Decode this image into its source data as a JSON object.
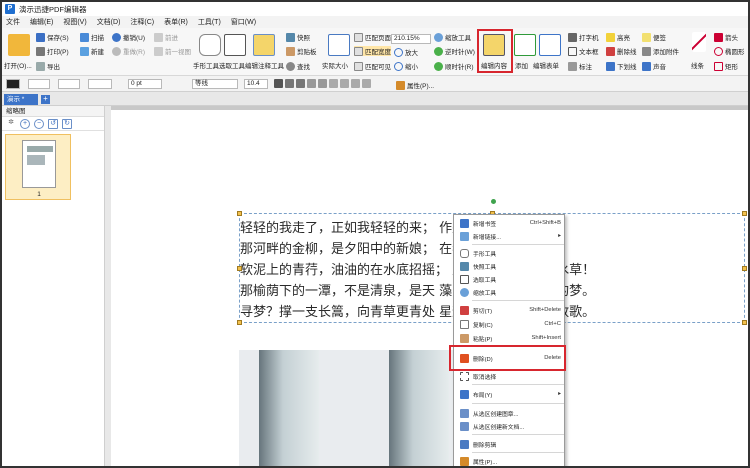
{
  "window": {
    "title": "演示迅捷PDF编辑器"
  },
  "menu": [
    "文件",
    "编辑(E)",
    "视图(V)",
    "文档(D)",
    "注释(C)",
    "表单(R)",
    "工具(T)",
    "窗口(W)"
  ],
  "ribbon": {
    "open": "打开(O)...",
    "save": "保存(S)",
    "scan": "扫描",
    "undo": "撤销(U)",
    "redo": "重做(R)",
    "forward": "前进",
    "back": "前一视图",
    "print": "打印(P)",
    "new": "新建",
    "export": "导出",
    "hand_tool": "手形工具",
    "select_tool": "选取工具",
    "edit_anno_tool": "编辑注释工具",
    "snapshot": "快照",
    "clipboard": "剪贴板",
    "find": "查找",
    "actual_size": "实际大小",
    "fit_page": "匹配页面",
    "fit_width": "匹配宽度",
    "fit_visible": "匹配可见",
    "zoom_value": "210.15%",
    "zoom_in": "放大",
    "zoom_out": "缩小",
    "zoom_tool": "缩放工具",
    "rotate_cw": "逆时针(W)",
    "rotate_ccw": "顺时针(R)",
    "edit_content": "编辑内容",
    "add": "添加",
    "edit_form": "编辑表单",
    "typewriter": "打字机",
    "textbox": "文本框",
    "annotation": "标注",
    "highlight": "高亮",
    "strikeout": "删除线",
    "underline": "下划线",
    "note": "便签",
    "attach": "添加附件",
    "sound": "声音",
    "line": "线条",
    "arrow": "箭头",
    "ellipse": "椭圆形",
    "rectangle": "矩形"
  },
  "format": {
    "size_pt": "0 pt",
    "font": "等线",
    "font_size": "10.4",
    "properties": "属性(P)..."
  },
  "tabs": {
    "doc_tab": "演示 *",
    "add": "+"
  },
  "left_panel": {
    "header": "缩略图",
    "page_number": "1"
  },
  "document": {
    "lines": [
      "轻轻的我走了，正如我轻轻的来；                       作别西天的云彩。",
      "那河畔的金柳，是夕阳中的新娘；                       在我的心头荡漾。",
      "软泥上的青荇，油油的在水底招摇；                  里，我甘心做一条水草！",
      "那榆荫下的一潭，不是清泉，是天                    藻间，沉淀着彩虹似的梦。",
      "寻梦？撑一支长篙，向青草更青处                    星辉，在星辉斑斓里放歌。"
    ]
  },
  "context_menu": {
    "items": [
      {
        "label": "新增书签",
        "key": "Ctrl+Shift+B",
        "icon": "bookmark-icon"
      },
      {
        "label": "新增链接...",
        "key": "▸",
        "icon": "link-icon"
      },
      {
        "label": "手形工具",
        "key": "",
        "icon": "hand-icon"
      },
      {
        "label": "快照工具",
        "key": "",
        "icon": "snapshot-icon"
      },
      {
        "label": "选取工具",
        "key": "",
        "icon": "select-icon"
      },
      {
        "label": "缩放工具",
        "key": "",
        "icon": "zoom-icon"
      },
      {
        "label": "剪切(T)",
        "key": "Shift+Delete",
        "icon": "scissors-icon"
      },
      {
        "label": "复制(C)",
        "key": "Ctrl+C",
        "icon": "copy-icon"
      },
      {
        "label": "粘贴(P)",
        "key": "Shift+Insert",
        "icon": "paste-icon"
      },
      {
        "label": "删除(D)",
        "key": "Delete",
        "icon": "trash-icon"
      },
      {
        "label": "取消选择",
        "key": "",
        "icon": "deselect-icon"
      },
      {
        "label": "布局(Y)",
        "key": "▸",
        "icon": "layout-icon"
      },
      {
        "label": "从选区创建图章...",
        "key": "",
        "icon": "stamp-icon"
      },
      {
        "label": "从选区创建新文档...",
        "key": "",
        "icon": "new-doc-icon"
      },
      {
        "label": "删除剪辑",
        "key": "",
        "icon": "remove-clip-icon"
      },
      {
        "label": "属性(P)...",
        "key": "",
        "icon": "properties-icon"
      }
    ]
  },
  "colors": {
    "highlight": "#d7262e",
    "tab": "#3d74c8"
  }
}
